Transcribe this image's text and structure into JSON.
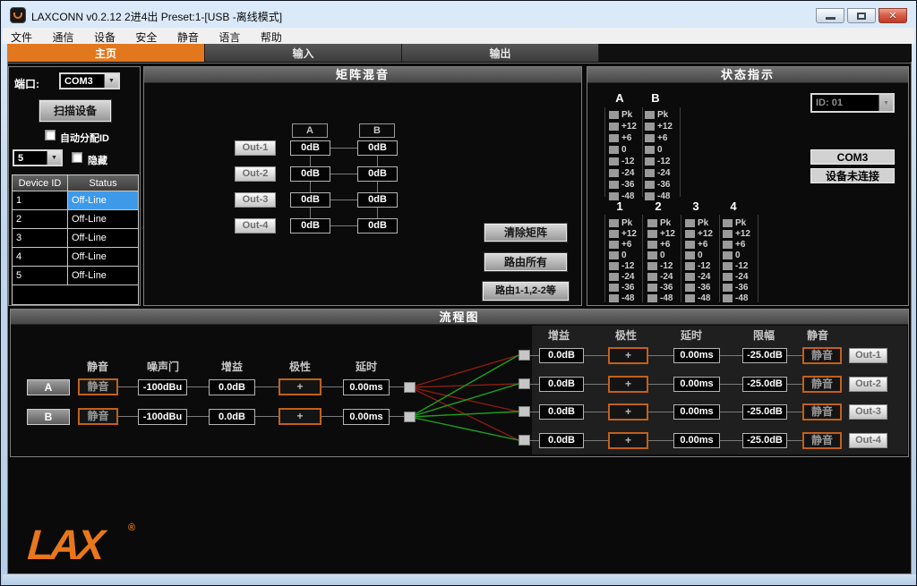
{
  "window": {
    "title": "LAXCONN v0.2.12 2进4出   Preset:1-[USB -离线模式]"
  },
  "icons": {
    "close": "✕",
    "dropdown_arrow": "▼"
  },
  "menu": {
    "items": [
      "文件",
      "通信",
      "设备",
      "安全",
      "静音",
      "语言",
      "帮助"
    ]
  },
  "tabs": {
    "home": "主页",
    "input": "输入",
    "output": "输出"
  },
  "port_panel": {
    "port_label": "端口:",
    "port_value": "COM3",
    "scan_button": "扫描设备",
    "auto_assign_label": "自动分配ID",
    "device_count": "5",
    "hide_label": "隐藏",
    "table": {
      "headers": [
        "Device ID",
        "Status"
      ],
      "rows": [
        {
          "id": "1",
          "status": "Off-Line"
        },
        {
          "id": "2",
          "status": "Off-Line"
        },
        {
          "id": "3",
          "status": "Off-Line"
        },
        {
          "id": "4",
          "status": "Off-Line"
        },
        {
          "id": "5",
          "status": "Off-Line"
        }
      ]
    }
  },
  "matrix_panel": {
    "title": "矩阵混音",
    "col_headers": [
      "A",
      "B"
    ],
    "rows": [
      {
        "label": "Out-1",
        "a": "0dB",
        "b": "0dB"
      },
      {
        "label": "Out-2",
        "a": "0dB",
        "b": "0dB"
      },
      {
        "label": "Out-3",
        "a": "0dB",
        "b": "0dB"
      },
      {
        "label": "Out-4",
        "a": "0dB",
        "b": "0dB"
      }
    ],
    "clear_button": "清除矩阵",
    "route_all_button": "路由所有",
    "route_direct_button": "路由1-1,2-2等"
  },
  "status_panel": {
    "title": "状态指示",
    "id_select_value": "ID: 01",
    "com_port": "COM3",
    "connection_status": "设备未连接",
    "input_meter_labels": [
      "A",
      "B"
    ],
    "output_meter_labels": [
      "1",
      "2",
      "3",
      "4"
    ],
    "meter_scale": [
      "Pk",
      "+12",
      "+6",
      "0",
      "-12",
      "-24",
      "-36",
      "-48"
    ]
  },
  "flow_panel": {
    "title": "流程图",
    "input_headers": [
      "静音",
      "噪声门",
      "增益",
      "极性",
      "延时"
    ],
    "output_headers": [
      "增益",
      "极性",
      "延时",
      "限幅",
      "静音"
    ],
    "inputs": [
      {
        "label": "A",
        "mute": "静音",
        "gate": "-100dBu",
        "gain": "0.0dB",
        "polarity": "+",
        "delay": "0.00ms"
      },
      {
        "label": "B",
        "mute": "静音",
        "gate": "-100dBu",
        "gain": "0.0dB",
        "polarity": "+",
        "delay": "0.00ms"
      }
    ],
    "outputs": [
      {
        "gain": "0.0dB",
        "polarity": "+",
        "delay": "0.00ms",
        "limiter": "-25.0dB",
        "mute": "静音",
        "label": "Out-1"
      },
      {
        "gain": "0.0dB",
        "polarity": "+",
        "delay": "0.00ms",
        "limiter": "-25.0dB",
        "mute": "静音",
        "label": "Out-2"
      },
      {
        "gain": "0.0dB",
        "polarity": "+",
        "delay": "0.00ms",
        "limiter": "-25.0dB",
        "mute": "静音",
        "label": "Out-3"
      },
      {
        "gain": "0.0dB",
        "polarity": "+",
        "delay": "0.00ms",
        "limiter": "-25.0dB",
        "mute": "静音",
        "label": "Out-4"
      }
    ]
  },
  "logo": {
    "text": "LAX",
    "mark": "®"
  },
  "colors": {
    "accent_orange": "#E2771E",
    "selected_row_blue": "#3E9AE8",
    "wire_red": "#8C1C10",
    "wire_green": "#1FA01F"
  }
}
